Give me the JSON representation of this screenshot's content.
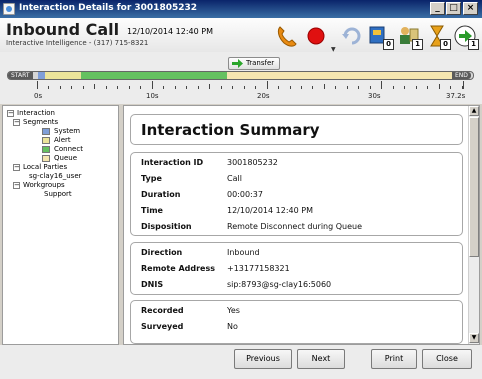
{
  "window": {
    "title": "Interaction Details for 3001805232"
  },
  "header": {
    "call_type": "Inbound Call",
    "call_time": "12/10/2014 12:40 PM",
    "company": "Interactive Intelligence - (317) 715-8321",
    "badges": {
      "transfer": "0",
      "consult": "1",
      "hold": "0",
      "next": "1"
    }
  },
  "timeline": {
    "start_label": "START",
    "end_label": "END",
    "transfer_label": "Transfer",
    "ticks": [
      "0s",
      "10s",
      "20s",
      "30s",
      "37.2s"
    ],
    "segments": [
      {
        "name": "System",
        "color": "#7f9ed8"
      },
      {
        "name": "Alert",
        "color": "#ece49a"
      },
      {
        "name": "Connect",
        "color": "#65c160"
      },
      {
        "name": "Queue",
        "color": "#f5e6b0"
      }
    ]
  },
  "tree": {
    "interaction": "Interaction",
    "segments": "Segments",
    "system": "System",
    "alert": "Alert",
    "connect": "Connect",
    "queue": "Queue",
    "local_parties": "Local Parties",
    "local_user": "sg-clay16_user",
    "workgroups": "Workgroups",
    "support": "Support"
  },
  "summary": {
    "title": "Interaction Summary",
    "section1": [
      {
        "key": "Interaction ID",
        "value": "3001805232"
      },
      {
        "key": "Type",
        "value": "Call"
      },
      {
        "key": "Duration",
        "value": "00:00:37"
      },
      {
        "key": "Time",
        "value": "12/10/2014 12:40 PM"
      },
      {
        "key": "Disposition",
        "value": "Remote Disconnect during Queue"
      }
    ],
    "section2": [
      {
        "key": "Direction",
        "value": "Inbound"
      },
      {
        "key": "Remote Address",
        "value": "+13177158321"
      },
      {
        "key": "DNIS",
        "value": "sip:8793@sg-clay16:5060"
      }
    ],
    "section3": [
      {
        "key": "Recorded",
        "value": "Yes"
      },
      {
        "key": "Surveyed",
        "value": "No"
      }
    ]
  },
  "footer": {
    "previous": "Previous",
    "next": "Next",
    "print": "Print",
    "close": "Close"
  }
}
